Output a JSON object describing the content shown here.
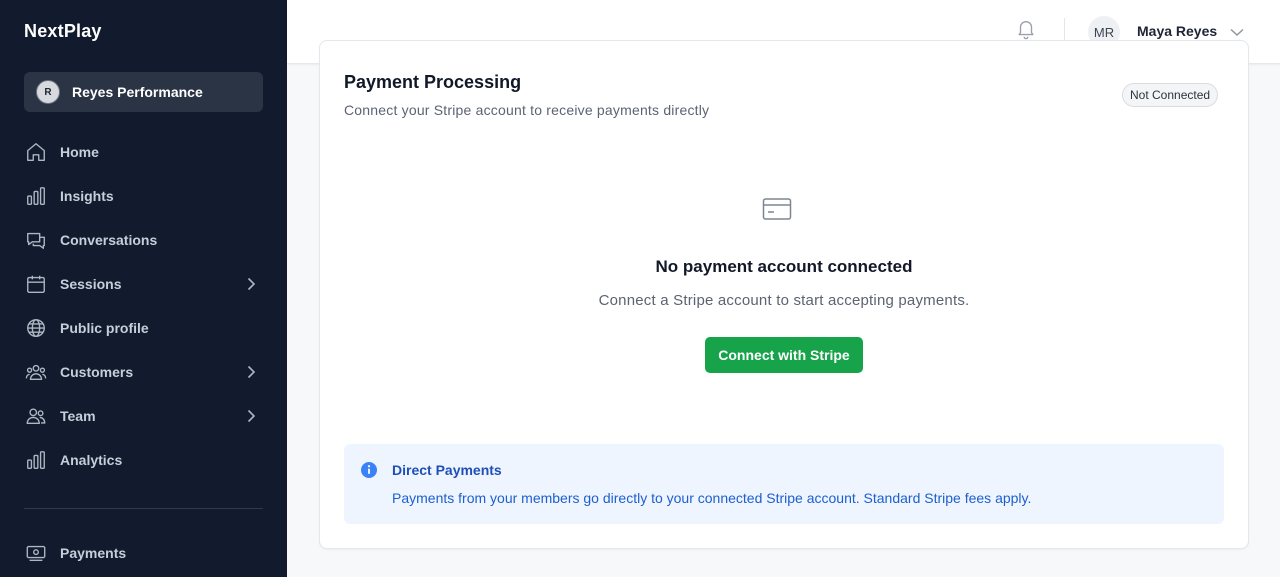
{
  "sidebar": {
    "brand": "NextPlay",
    "workspace": {
      "initial": "R",
      "name": "Reyes Performance"
    },
    "items": [
      {
        "label": "Home",
        "icon": "home-icon",
        "has_submenu": false
      },
      {
        "label": "Insights",
        "icon": "bar-chart-icon",
        "has_submenu": false
      },
      {
        "label": "Conversations",
        "icon": "chat-icon",
        "has_submenu": false
      },
      {
        "label": "Sessions",
        "icon": "calendar-icon",
        "has_submenu": true
      },
      {
        "label": "Public profile",
        "icon": "globe-icon",
        "has_submenu": false
      },
      {
        "label": "Customers",
        "icon": "users-icon",
        "has_submenu": true
      },
      {
        "label": "Team",
        "icon": "team-icon",
        "has_submenu": true
      },
      {
        "label": "Analytics",
        "icon": "bar-chart-icon",
        "has_submenu": false
      }
    ],
    "bottom_item": {
      "label": "Payments",
      "icon": "money-icon"
    }
  },
  "header": {
    "bell_icon": "bell-icon",
    "user_initials": "MR",
    "user_name": "Maya Reyes",
    "chevron_icon": "chevron-down-icon"
  },
  "card": {
    "title": "Payment Processing",
    "subtitle": "Connect your Stripe account to receive payments directly",
    "status_badge": "Not Connected",
    "empty_state": {
      "icon": "credit-card-icon",
      "title": "No payment account connected",
      "description": "Connect a Stripe account to start accepting payments.",
      "button_label": "Connect with Stripe"
    },
    "info": {
      "icon": "info-icon",
      "title": "Direct Payments",
      "text": "Payments from your members go directly to your connected Stripe account. Standard Stripe fees apply."
    }
  },
  "colors": {
    "sidebar_bg": "#111b2d",
    "accent_green": "#16a34a",
    "info_blue": "#1d5fd0",
    "info_bg": "#eff5ff"
  }
}
